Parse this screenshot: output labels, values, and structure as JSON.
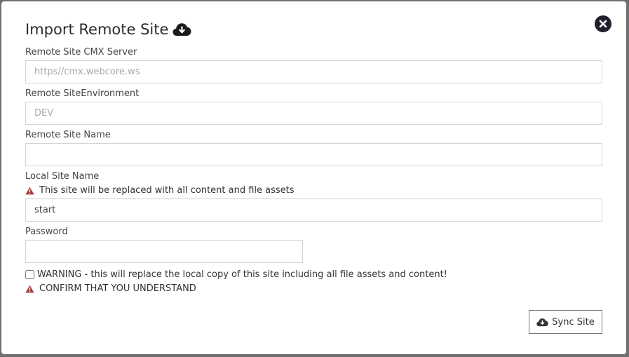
{
  "modal": {
    "title": "Import Remote Site",
    "title_icon": "cloud-download-icon",
    "close_icon": "close-circle-icon"
  },
  "fields": {
    "cmx_server": {
      "label": "Remote Site CMX Server",
      "value": "",
      "placeholder": "https//cmx.webcore.ws"
    },
    "environment": {
      "label": "Remote SiteEnvironment",
      "value": "",
      "placeholder": "DEV"
    },
    "remote_name": {
      "label": "Remote Site Name",
      "value": "",
      "placeholder": ""
    },
    "local_name": {
      "label": "Local Site Name",
      "warning": "This site will be replaced with all content and file assets",
      "value": "start",
      "placeholder": ""
    },
    "password": {
      "label": "Password",
      "value": "",
      "placeholder": ""
    }
  },
  "confirm": {
    "checkbox_label": "WARNING - this will replace the local copy of this site including all file assets and content!",
    "checked": false,
    "warning": "CONFIRM THAT YOU UNDERSTAND"
  },
  "actions": {
    "sync_label": "Sync Site"
  },
  "colors": {
    "warning_icon": "#a33a3a",
    "close_button": "#1f1f2b",
    "input_border": "#d4d4d4"
  }
}
